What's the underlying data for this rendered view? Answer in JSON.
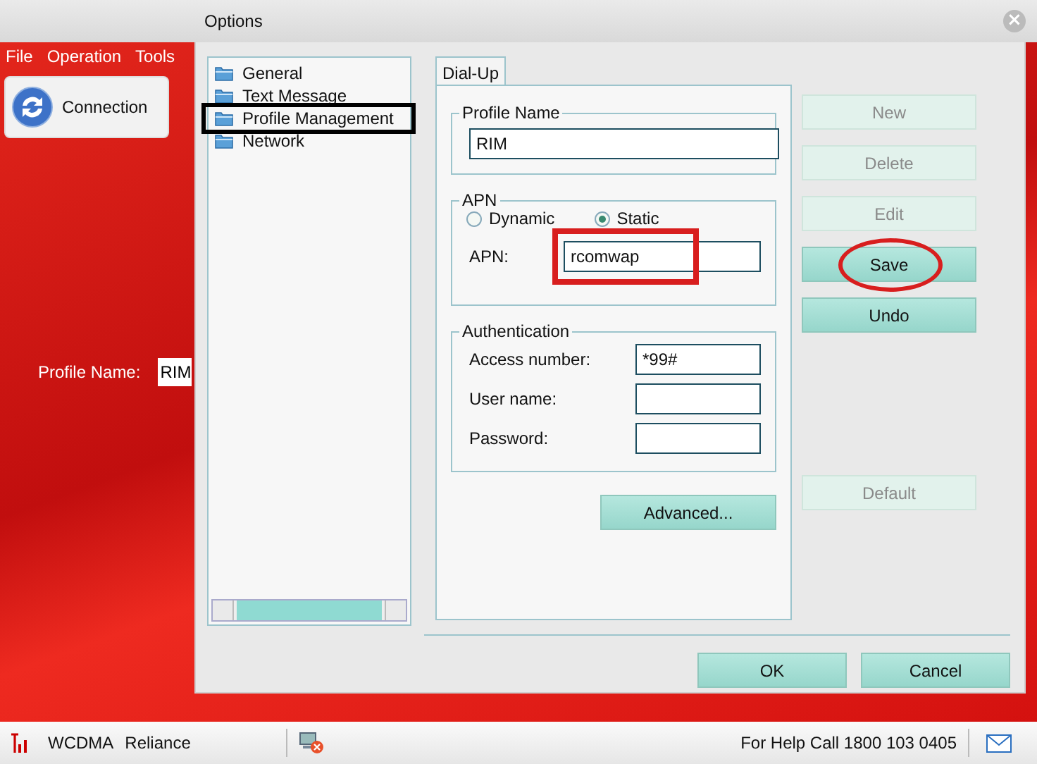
{
  "window": {
    "title": "Options",
    "close": "×"
  },
  "app": {
    "menu": [
      "File",
      "Operation",
      "Tools"
    ],
    "connection_button": "Connection",
    "profile_name": {
      "label": "Profile Name:",
      "value": "RIM"
    }
  },
  "tree": [
    {
      "label": "General",
      "selected": false
    },
    {
      "label": "Text Message",
      "selected": false
    },
    {
      "label": "Profile Management",
      "selected": true
    },
    {
      "label": "Network",
      "selected": false
    }
  ],
  "tabs": [
    {
      "label": "Dial-Up",
      "selected": true
    }
  ],
  "profile_name": {
    "title": "Profile Name",
    "value": "RIM"
  },
  "apn": {
    "title": "APN",
    "options": [
      {
        "label": "Dynamic",
        "selected": false
      },
      {
        "label": "Static",
        "selected": true
      }
    ],
    "label": "APN:",
    "value": "rcomwap"
  },
  "authentication": {
    "title": "Authentication",
    "fields": [
      {
        "label": "Access number:",
        "value": "*99#"
      },
      {
        "label": "User name:"
      },
      {
        "label": "Password:"
      }
    ]
  },
  "advanced_button": "Advanced...",
  "side_buttons": [
    {
      "label": "New",
      "disabled": true
    },
    {
      "label": "Delete",
      "disabled": true
    },
    {
      "label": "Edit",
      "disabled": true
    },
    {
      "label": "Save",
      "disabled": false
    },
    {
      "label": "Undo",
      "disabled": false
    },
    {
      "label": "Default",
      "disabled": true
    }
  ],
  "dialog_buttons": [
    "OK",
    "Cancel"
  ],
  "status_bar": {
    "technology": "WCDMA",
    "operator": "Reliance",
    "help": "For Help Call 1800 103 0405"
  }
}
